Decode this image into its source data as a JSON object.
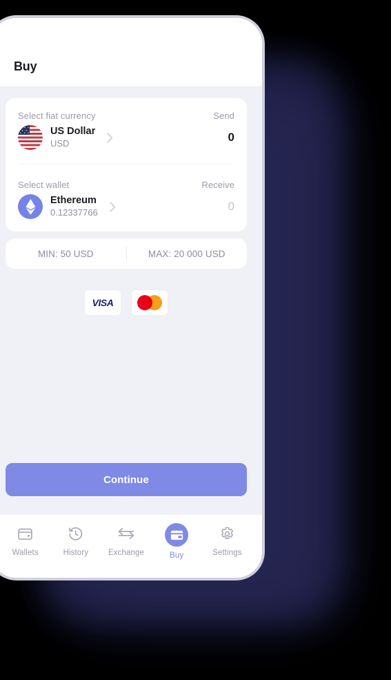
{
  "header": {
    "title": "Buy"
  },
  "exchange": {
    "fiat": {
      "label": "Select fiat currency",
      "side_label": "Send",
      "name": "US Dollar",
      "ticker": "USD",
      "amount": "0",
      "avatar_icon": "us-flag-icon",
      "chevron_icon": "chevron-right-icon"
    },
    "wallet": {
      "label": "Select wallet",
      "side_label": "Receive",
      "name": "Ethereum",
      "balance": "0.12337766",
      "amount": "0",
      "avatar_icon": "ethereum-icon",
      "chevron_icon": "chevron-right-icon"
    }
  },
  "limits": {
    "min": "MIN: 50 USD",
    "max": "MAX: 20 000 USD"
  },
  "payment_methods": [
    {
      "name": "Visa",
      "label": "VISA",
      "icon": "visa-icon"
    },
    {
      "name": "Mastercard",
      "label": "",
      "icon": "mastercard-icon"
    }
  ],
  "actions": {
    "continue_label": "Continue"
  },
  "tabbar": {
    "items": [
      {
        "label": "Wallets",
        "icon": "wallet-icon",
        "active": false
      },
      {
        "label": "History",
        "icon": "clock-icon",
        "active": false
      },
      {
        "label": "Exchange",
        "icon": "exchange-icon",
        "active": false
      },
      {
        "label": "Buy",
        "icon": "card-icon",
        "active": true
      },
      {
        "label": "Settings",
        "icon": "gear-icon",
        "active": false
      }
    ]
  },
  "colors": {
    "accent": "#7f8ae6",
    "background": "#f0f1f6",
    "shadow": "#191a3c",
    "visa_blue": "#1a1f71",
    "mastercard_red": "#eb001b",
    "mastercard_orange": "#f79e1b"
  }
}
